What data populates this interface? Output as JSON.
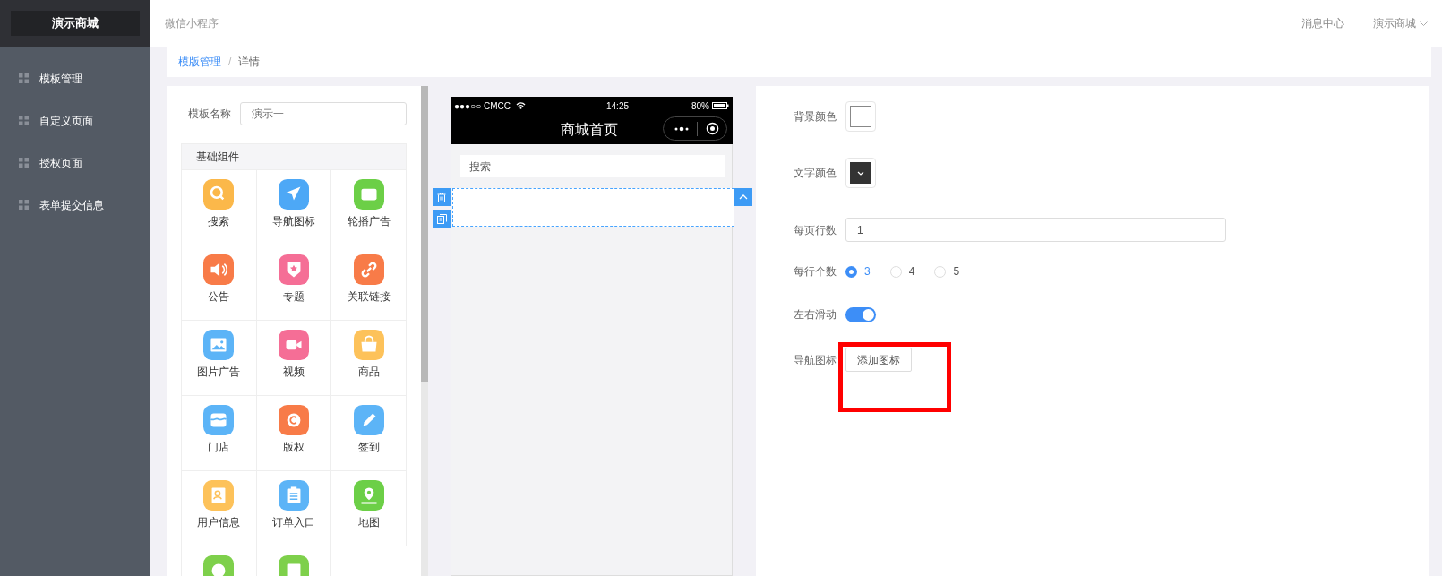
{
  "sidebar": {
    "logo": "演示商城",
    "items": [
      {
        "label": "模板管理"
      },
      {
        "label": "自定义页面"
      },
      {
        "label": "授权页面"
      },
      {
        "label": "表单提交信息"
      }
    ]
  },
  "header": {
    "title": "微信小程序",
    "link": "消息中心",
    "user": "演示商城"
  },
  "breadcrumb": {
    "items": [
      {
        "label": "模版管理",
        "kind": "link"
      },
      {
        "label": "详情",
        "kind": "current"
      }
    ],
    "separator": "/"
  },
  "template_name": {
    "label": "模板名称",
    "value": "演示一"
  },
  "components": {
    "title": "基础组件",
    "items": [
      {
        "label": "搜索",
        "kind": "search",
        "color": "#fbb84a"
      },
      {
        "label": "导航图标",
        "kind": "arrow",
        "color": "#4da8f6"
      },
      {
        "label": "轮播广告",
        "kind": "slides",
        "color": "#6ccf47"
      },
      {
        "label": "公告",
        "kind": "speaker",
        "color": "#f87b48"
      },
      {
        "label": "专题",
        "kind": "badge",
        "color": "#f56e96"
      },
      {
        "label": "关联链接",
        "kind": "link",
        "color": "#f87b48"
      },
      {
        "label": "图片广告",
        "kind": "image",
        "color": "#5cb4f7"
      },
      {
        "label": "视频",
        "kind": "video",
        "color": "#f56e96"
      },
      {
        "label": "商品",
        "kind": "bag",
        "color": "#fdc25a"
      },
      {
        "label": "门店",
        "kind": "store",
        "color": "#5cb4f7"
      },
      {
        "label": "版权",
        "kind": "copyright",
        "color": "#f87b48"
      },
      {
        "label": "签到",
        "kind": "pencil",
        "color": "#5cb4f7"
      },
      {
        "label": "用户信息",
        "kind": "user",
        "color": "#fdc25a"
      },
      {
        "label": "订单入口",
        "kind": "clipboard",
        "color": "#5cb4f7"
      },
      {
        "label": "地图",
        "kind": "pin",
        "color": "#6ccf47"
      },
      {
        "kind": "smile",
        "color": "#7ed04b"
      },
      {
        "kind": "doc",
        "color": "#7ed04b"
      }
    ]
  },
  "phone": {
    "carrier": "●●●○○ CMCC",
    "time": "14:25",
    "battery": "80%",
    "page_title": "商城首页",
    "search_placeholder": "搜索"
  },
  "settings": {
    "background_color": {
      "label": "背景颜色",
      "color": "#ffffff"
    },
    "text_color": {
      "label": "文字颜色",
      "color": "#333333"
    },
    "rows_per_page": {
      "label": "每页行数",
      "value": "1"
    },
    "per_row": {
      "label": "每行个数",
      "options": [
        {
          "label": "3",
          "selected": true
        },
        {
          "label": "4",
          "selected": false
        },
        {
          "label": "5",
          "selected": false
        }
      ]
    },
    "scroll": {
      "label": "左右滑动",
      "on": true
    },
    "nav_icons": {
      "label": "导航图标",
      "button": "添加图标"
    }
  },
  "annotations": [
    {
      "kind": "frame"
    }
  ]
}
